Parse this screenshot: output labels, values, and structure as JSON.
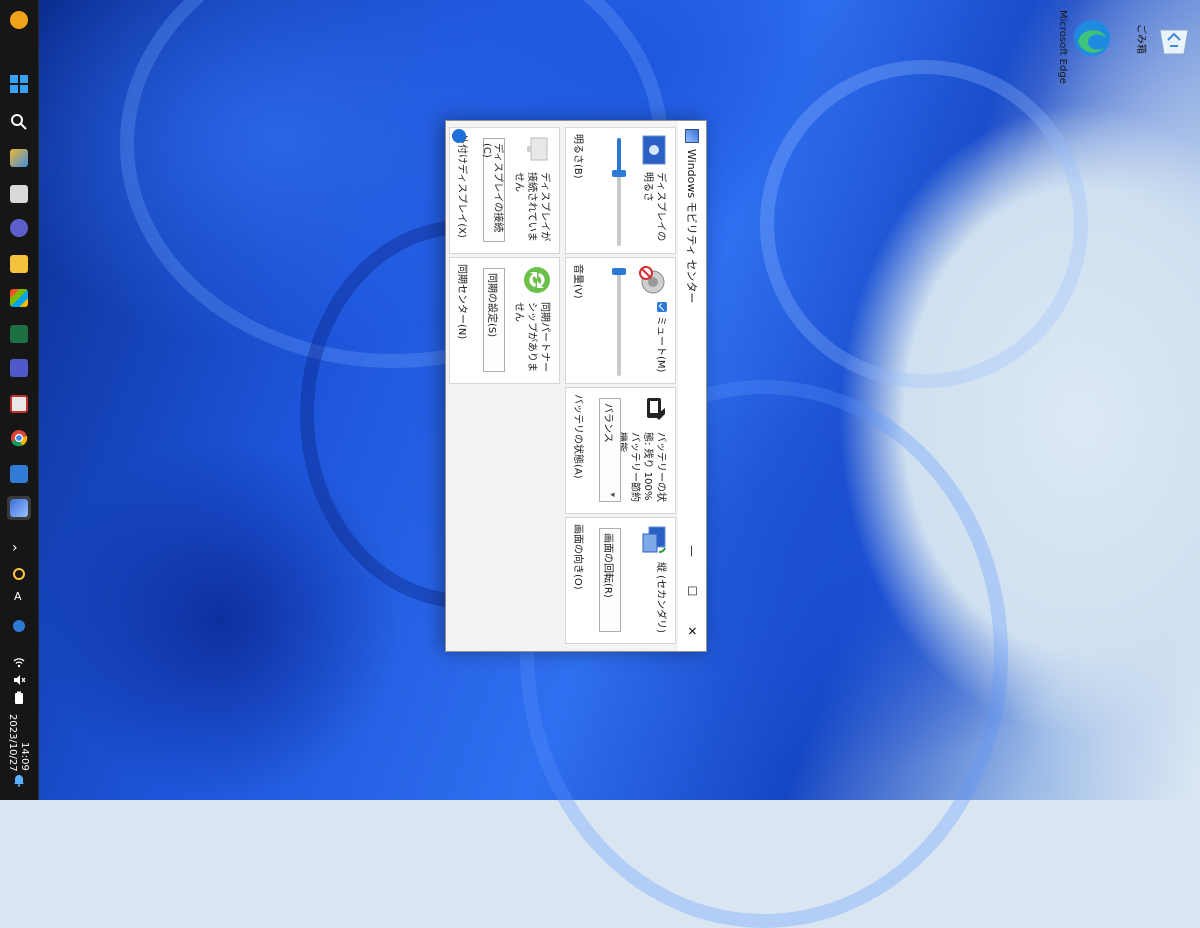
{
  "window": {
    "title": "Windows モビリティ センター",
    "minimize_glyph": "—",
    "maximize_glyph": "☐",
    "close_glyph": "✕"
  },
  "tiles": {
    "brightness": {
      "text": "ディスプレイの明るさ",
      "label": "明るさ(B)",
      "level": 0.32
    },
    "volume": {
      "text": "ミュート(M)",
      "label": "音量(V)",
      "level": 0.03,
      "muted": true
    },
    "battery": {
      "text": "バッテリーの状態: 残り 100% バッテリー節約機能...",
      "select_value": "バランス",
      "label": "バッテリの状態(A)"
    },
    "rotation": {
      "text": "縦 (セカンダリ)",
      "button_label": "画面の回転(R)",
      "label": "画面の向き(O)"
    },
    "display": {
      "text": "ディスプレイが接続されていません",
      "button_label": "ディスプレイの接続(C)",
      "label": "外付けディスプレイ(X)"
    },
    "sync": {
      "text": "同期パートナーシップがありません",
      "button_label": "同期の設定(S)",
      "label": "同期センター(N)"
    }
  },
  "taskbar": {
    "time": "14:09",
    "date": "2023/10/27",
    "ime": "A",
    "overflow_glyph": "›"
  },
  "desktop_icons": [
    {
      "label": "Microsoft Edge",
      "icon": "edge-icon"
    },
    {
      "label": "ごみ箱",
      "icon": "recycle-bin-icon"
    }
  ],
  "colors": {
    "accent": "#2d7ad6",
    "taskbar": "#161616",
    "wallpaper_blue": "#1d55da"
  }
}
